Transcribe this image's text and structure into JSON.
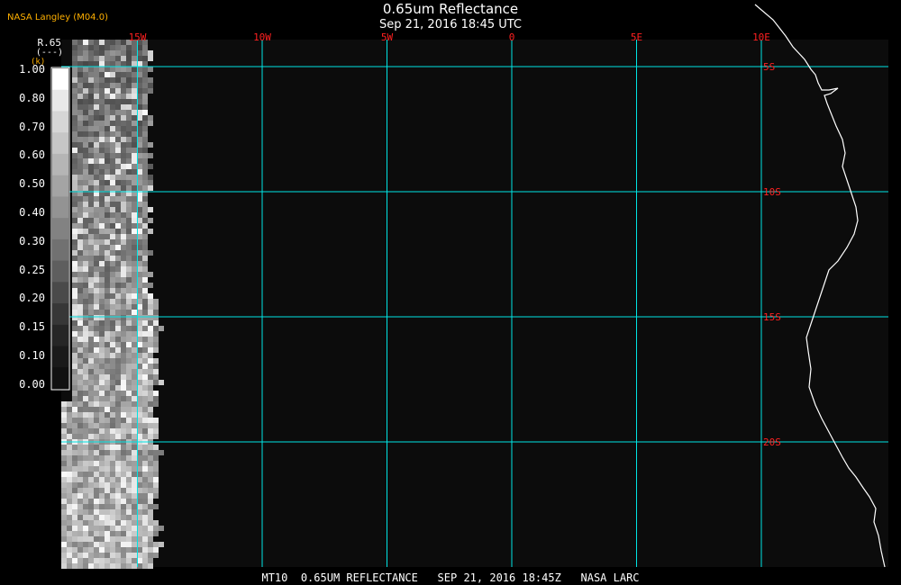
{
  "header": {
    "title": "0.65um Reflectance",
    "timestamp": "Sep 21, 2016 18:45 UTC",
    "producer": "NASA Langley (M04.0)"
  },
  "legend": {
    "title": "R.65",
    "unit": "(---)",
    "marker": "(k)",
    "ticks": [
      "1.00",
      "0.80",
      "0.70",
      "0.60",
      "0.50",
      "0.40",
      "0.30",
      "0.25",
      "0.20",
      "0.15",
      "0.10",
      "0.00"
    ],
    "grays": [
      "#ffffff",
      "#e8e8e8",
      "#d6d6d6",
      "#c6c6c6",
      "#b5b5b5",
      "#a4a4a4",
      "#939393",
      "#828282",
      "#717171",
      "#5e5e5e",
      "#4a4a4a",
      "#373737",
      "#262626",
      "#1a1a1a",
      "#111111"
    ]
  },
  "map": {
    "longitudes": [
      {
        "label": "15W",
        "value": -15
      },
      {
        "label": "10W",
        "value": -10
      },
      {
        "label": "5W",
        "value": -5
      },
      {
        "label": "0",
        "value": 0
      },
      {
        "label": "5E",
        "value": 5
      },
      {
        "label": "10E",
        "value": 10
      }
    ],
    "latitudes": [
      {
        "label": "5S",
        "value": -5
      },
      {
        "label": "10S",
        "value": -10
      },
      {
        "label": "15S",
        "value": -15
      },
      {
        "label": "20S",
        "value": -20
      }
    ],
    "colors": {
      "grid": "#00e5e5",
      "label": "#ff2020",
      "background": "#0c0c0c",
      "coast": "#ffffff"
    }
  },
  "footer": {
    "text": "MT10  0.65UM REFLECTANCE   SEP 21, 2016 18:45Z   NASA LARC"
  }
}
